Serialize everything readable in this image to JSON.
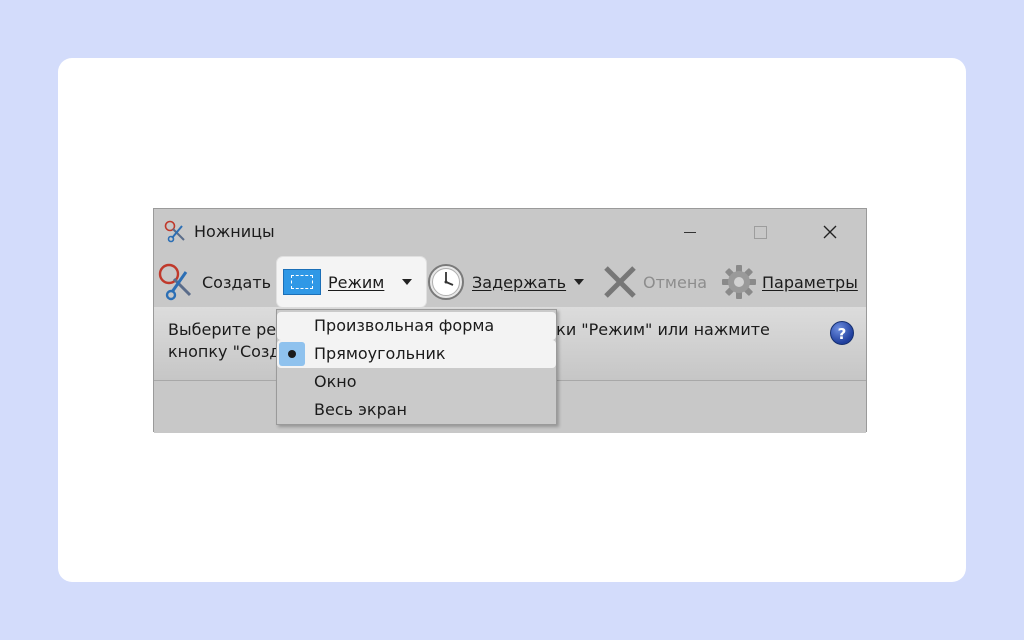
{
  "window": {
    "title": "Ножницы"
  },
  "toolbar": {
    "create_label": "Создать",
    "mode_label": "Режим",
    "delay_label": "Задержать",
    "cancel_label": "Отмена",
    "options_label": "Параметры"
  },
  "info": {
    "text": "Выберите режим фрагмента с помощью кнопки \"Режим\" или нажмите\nкнопку \"Создать\"."
  },
  "mode_menu": {
    "items": [
      {
        "label": "Произвольная форма",
        "selected": false
      },
      {
        "label": "Прямоугольник",
        "selected": true
      },
      {
        "label": "Окно",
        "selected": false
      },
      {
        "label": "Весь экран",
        "selected": false
      }
    ]
  },
  "icons": {
    "app": "scissors-icon",
    "create": "scissors-icon",
    "mode": "rectangle-snip-icon",
    "delay": "clock-icon",
    "cancel": "x-icon",
    "options": "gear-icon",
    "help": "help-icon"
  },
  "colors": {
    "accent": "#2f98e6",
    "selected_bg": "#8fc2ee",
    "help": "#203f9e"
  }
}
